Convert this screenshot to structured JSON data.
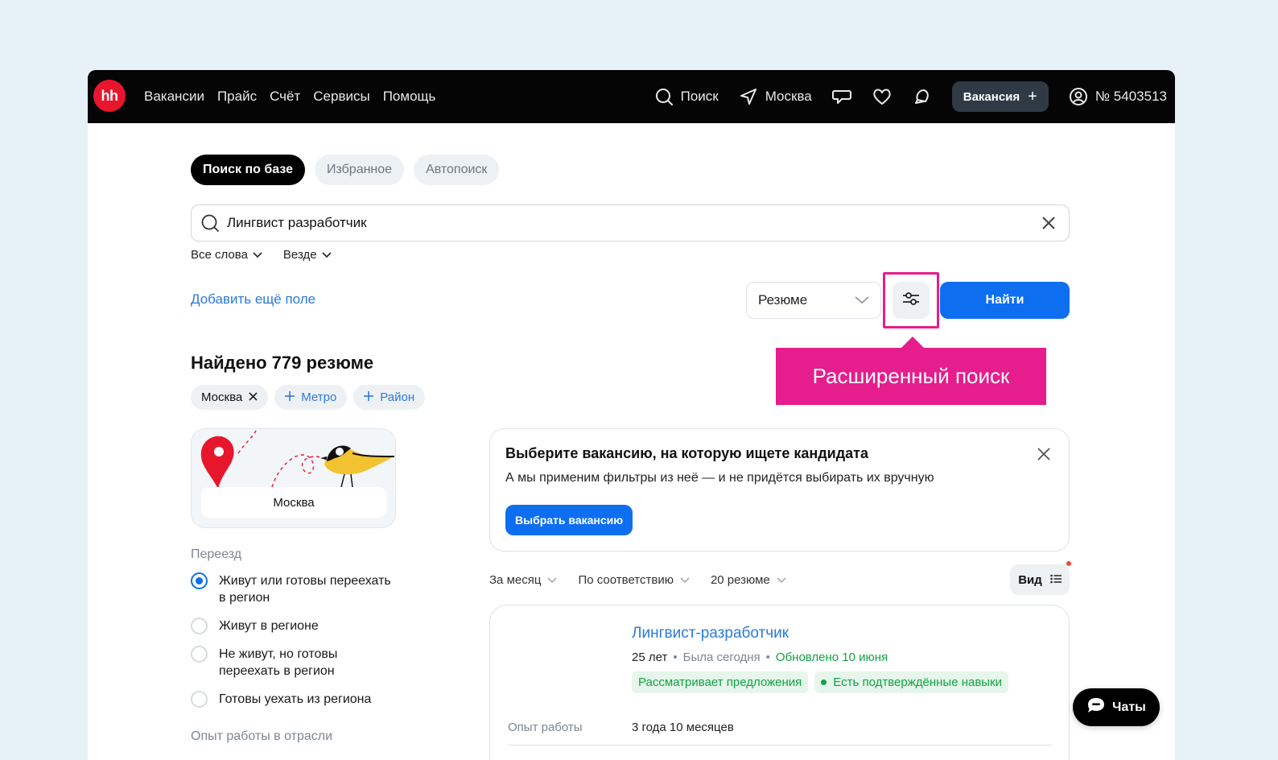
{
  "logo": "hh",
  "nav": {
    "links": [
      "Вакансии",
      "Прайс",
      "Счёт",
      "Сервисы",
      "Помощь"
    ],
    "search_label": "Поиск",
    "city_label": "Москва",
    "vacancy_button": "Вакансия",
    "vacancy_plus": "+",
    "account": "№ 5403513"
  },
  "tabs": [
    "Поиск по базе",
    "Избранное",
    "Автопоиск"
  ],
  "search": {
    "value": "Лингвист разработчик"
  },
  "dropdowns": [
    "Все слова",
    "Везде"
  ],
  "add_field": "Добавить ещё поле",
  "type_select": "Резюме",
  "find_button": "Найти",
  "tooltip": "Расширенный поиск",
  "found_title": "Найдено 779 резюме",
  "chips": {
    "city": "Москва",
    "metro": "Метро",
    "district": "Район"
  },
  "map_card_label": "Москва",
  "relocation": {
    "title": "Переезд",
    "options": [
      "Живут или готовы переехать в регион",
      "Живут в регионе",
      "Не живут, но готовы переехать в регион",
      "Готовы уехать из региона"
    ],
    "selected": 0
  },
  "industry_exp_title": "Опыт работы в отрасли",
  "banner": {
    "title": "Выберите вакансию, на которую ищете кандидата",
    "text": "А мы применим фильтры из неё — и не придётся выбирать их вручную",
    "button": "Выбрать вакансию"
  },
  "sorts": [
    "За месяц",
    "По соответствию",
    "20 резюме"
  ],
  "view_button": "Вид",
  "resume": {
    "title": "Лингвист-разработчик",
    "age": "25 лет",
    "sep": "•",
    "last_seen": "Была сегодня",
    "updated": "Обновлено 10 июня",
    "badges": [
      "Рассматривает предложения",
      "Есть подтверждённые навыки"
    ],
    "experience_label": "Опыт работы",
    "experience_value": "3 года 10 месяцев"
  },
  "chats_button": "Чаты",
  "colors": {
    "accent_blue": "#0d6ff0",
    "highlight_pink": "#e61d8c",
    "brand_red": "#e8162d",
    "green": "#12a344"
  }
}
